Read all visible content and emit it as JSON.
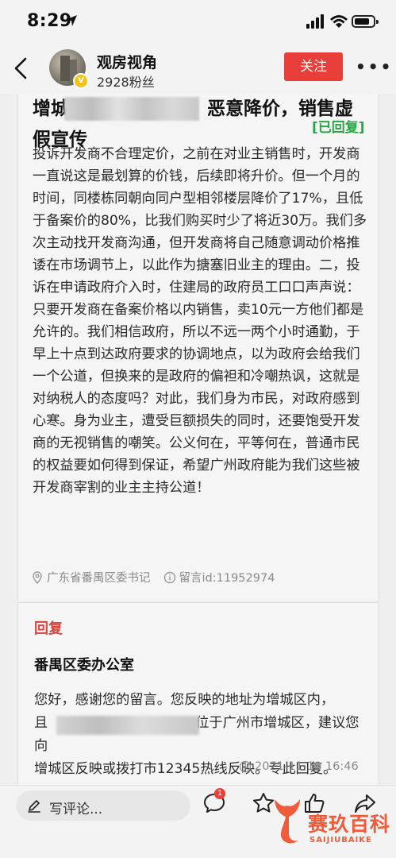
{
  "status_bar": {
    "time": "8:29"
  },
  "header": {
    "account_name": "观房视角",
    "follower_count": "2928粉丝",
    "follow_label": "关注",
    "more_label": "•••",
    "verified_mark": "V"
  },
  "complaint": {
    "title_prefix": "增城",
    "title_suffix": "恶意降价，销售虚",
    "title_line2": "假宣传",
    "replied_tag": "[已回复]",
    "body": "投诉开发商不合理定价，之前在对业主销售时，开发商一直说这是最划算的价钱，后续即将升价。但一个月的时间，同楼栋同朝向同户型相邻楼层降价了17%，且低于备案价的80%，比我们购买时少了将近30万。我们多次主动找开发商沟通，但开发商将自己随意调动价格推诿在市场调节上，以此作为搪塞旧业主的理由。二，投诉在申请政府介入时，住建局的政府员工口口声声说：只要开发商在备案价格以内销售，卖10元一方他们都是允许的。我们相信政府，所以不远一两个小时通勤，于早上十点到达政府要求的协调地点，以为政府会给我们一个公道，但换来的是政府的偏袒和冷嘲热讽，这就是对纳税人的态度吗？对此，我们身为市民，对政府感到心寒。身为业主，遭受巨额损失的同时，还要饱受开发商的无视销售的嘲笑。公义何在，平等何在，普通市民的权益要如何得到保证，希望广州政府能为我们这些被开发商宰割的业主主持公道！",
    "location": "广东省番禺区委书记",
    "message_id": "留言id:11952974"
  },
  "reply": {
    "label": "回复",
    "org": "番禺区委办公室",
    "body_line1": "您好，感谢您的留言。您反映的地址为增城区内，",
    "body_line2_prefix": "且",
    "body_line2_suffix": "位于广州市增城区，建议您向",
    "body_line3": "增城区反映或拨打市12345热线反映。专此回复。",
    "time": "2021-11-19 16:46"
  },
  "bottom_bar": {
    "comment_placeholder": "写评论...",
    "comment_badge": "1"
  },
  "watermark": {
    "cn": "赛玖百科",
    "en": "SAIJIUBAIKE"
  }
}
